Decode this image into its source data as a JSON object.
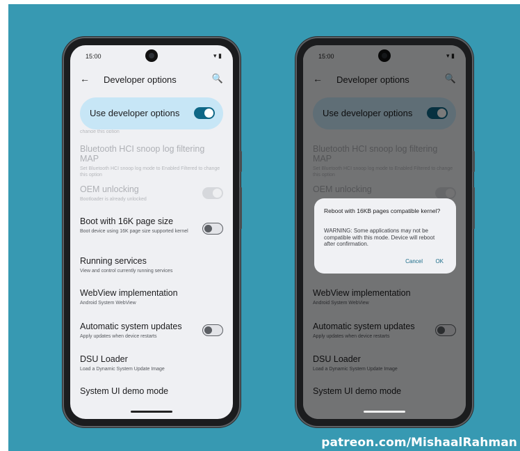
{
  "status": {
    "time": "15:00",
    "icons": "▾ ▮"
  },
  "appbar": {
    "back": "←",
    "title": "Developer options",
    "search": "🔍"
  },
  "master": {
    "label": "Use developer options",
    "enabled": true
  },
  "cut_text": "change this option",
  "items": [
    {
      "title": "Bluetooth HCI snoop log filtering MAP",
      "summary": "Set Bluetooth HCI snoop log mode to Enabled Filtered to change this option",
      "disabled": true
    },
    {
      "title": "OEM unlocking",
      "summary": "Bootloader is already unlocked",
      "disabled": true
    },
    {
      "title": "Boot with 16K page size",
      "summary": "Boot device using 16K page size supported kernel"
    },
    {
      "title": "Running services",
      "summary": "View and control currently running services"
    },
    {
      "title": "WebView implementation",
      "summary": "Android System WebView"
    },
    {
      "title": "Automatic system updates",
      "summary": "Apply updates when device restarts"
    },
    {
      "title": "DSU Loader",
      "summary": "Load a Dynamic System Update Image"
    },
    {
      "title": "System UI demo mode",
      "summary": ""
    }
  ],
  "dialog": {
    "title": "Reboot with 16KB pages compatible kernel?",
    "message": "WARNING: Some applications may not be compatible with this mode. Device will reboot after confirmation.",
    "cancel": "Cancel",
    "ok": "OK"
  },
  "watermark": "patreon.com/MishaalRahman",
  "colors": {
    "background": "#3799b2",
    "accent": "#0f6786",
    "highlight": "#c7e6f6"
  }
}
